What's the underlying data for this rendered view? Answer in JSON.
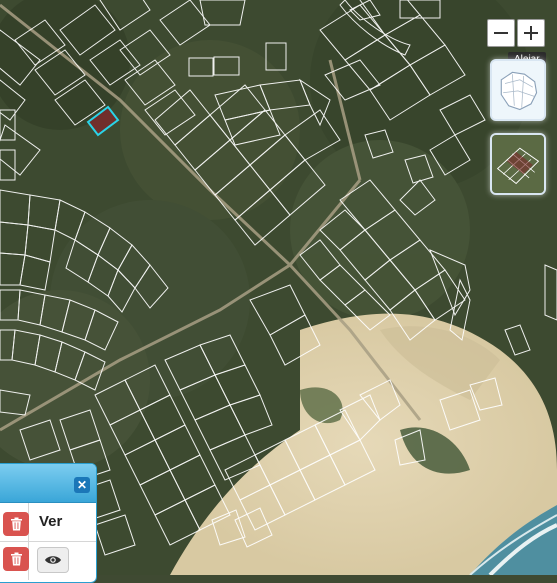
{
  "map": {
    "type": "satellite cadastral parcel map",
    "parcel_outline_color": "#ffffff",
    "selected_parcel_color": "#7a2a2a",
    "selected_parcel_outline": "#2ad4e8"
  },
  "zoom_controls": {
    "zoom_out_icon": "minus-icon",
    "zoom_in_icon": "plus-icon",
    "tooltip": "Alejar"
  },
  "layers": [
    {
      "name": "country-map-layer",
      "icon": "map-outline-icon"
    },
    {
      "name": "parcels-layer",
      "icon": "parcel-grid-icon"
    }
  ],
  "panel": {
    "close_icon": "close-icon",
    "column_header": "Ver",
    "delete_icon": "trash-icon",
    "view_icon": "eye-icon"
  }
}
